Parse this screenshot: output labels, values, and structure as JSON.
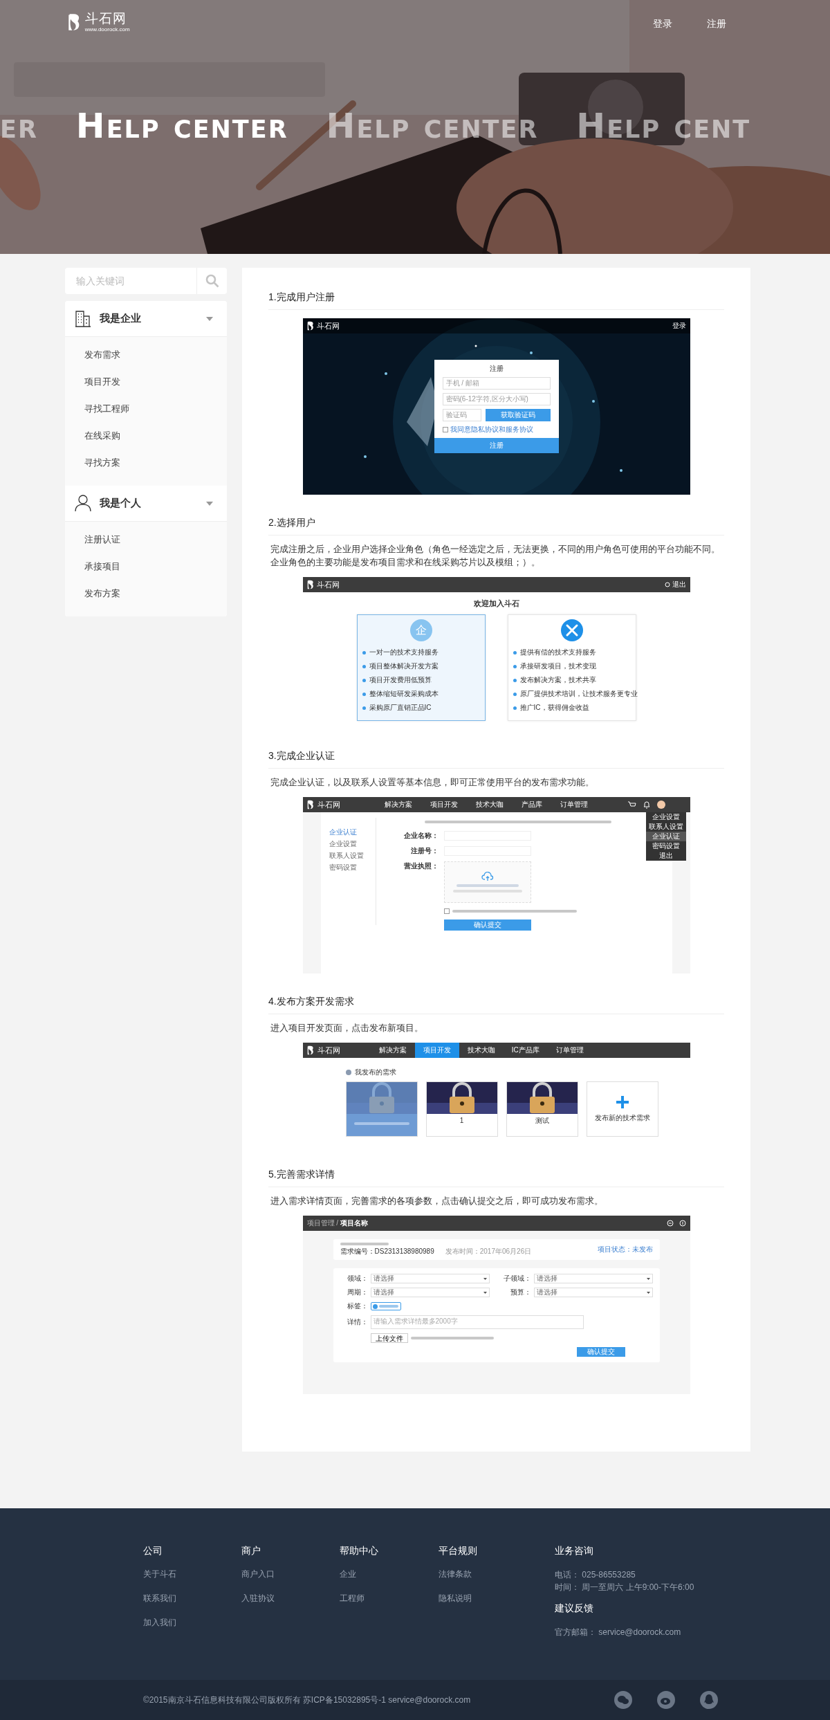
{
  "header": {
    "brand": "斗石网",
    "url": "www.doorock.com",
    "nav": [
      "登录",
      "注册"
    ],
    "banner": [
      {
        "text": "er",
        "highlighted": false
      },
      {
        "text": "Help center",
        "highlighted": true
      },
      {
        "text": "Help center",
        "highlighted": false
      },
      {
        "text": "Help cent",
        "highlighted": false
      }
    ]
  },
  "sidebar": {
    "search_placeholder": "输入关键词",
    "groups": [
      {
        "title": "我是企业",
        "kind": "building",
        "expanded": true,
        "items": [
          "发布需求",
          "项目开发",
          "寻找工程师",
          "在线采购",
          "寻找方案"
        ]
      },
      {
        "title": "我是个人",
        "kind": "person",
        "expanded": true,
        "items": [
          "注册认证",
          "承接项目",
          "发布方案"
        ]
      }
    ]
  },
  "steps": [
    {
      "title": "1.完成用户注册",
      "screen": {
        "kind": "register",
        "brand": "斗石网",
        "nav": "登录",
        "form_title": "注册",
        "fields": [
          "手机 / 邮箱",
          "密码(6-12字符,区分大小写)"
        ],
        "code_placeholder": "验证码",
        "code_button": "获取验证码",
        "agree_text": "我同意隐私协议和服务协议",
        "agree_checked": false,
        "submit": "注册"
      }
    },
    {
      "title": "2.选择用户",
      "description": "完成注册之后，企业用户选择企业角色（角色一经选定之后，无法更换，不同的用户角色可使用的平台功能不同。企业角色的主要功能是发布项目需求和在线采购芯片以及模组；）。",
      "screen": {
        "kind": "roles",
        "brand": "斗石网",
        "exit": "退出",
        "title": "欢迎加入斗石",
        "roles": [
          {
            "kind": "letter",
            "icon_text": "企",
            "selected": true,
            "points": [
              "一对一的技术支持服务",
              "项目整体解决开发方案",
              "项目开发费用低预算",
              "整体缩短研发采购成本",
              "采购原厂直销正品IC"
            ]
          },
          {
            "kind": "tools",
            "selected": false,
            "points": [
              "提供有偿的技术支持服务",
              "承接研发项目，技术变现",
              "发布解决方案，技术共享",
              "原厂提供技术培训，让技术服务更专业",
              "推广IC，获得佣金收益"
            ]
          }
        ]
      }
    },
    {
      "title": "3.完成企业认证",
      "description": "完成企业认证，以及联系人设置等基本信息，即可正常使用平台的发布需求功能。",
      "screen": {
        "kind": "verify",
        "brand": "斗石网",
        "nav": [
          "解决方案",
          "项目开发",
          "技术大咖",
          "产品库",
          "订单管理"
        ],
        "dropdown": [
          {
            "label": "企业设置",
            "selected": false
          },
          {
            "label": "联系人设置",
            "selected": false
          },
          {
            "label": "企业认证",
            "selected": true
          },
          {
            "label": "密码设置",
            "selected": false
          },
          {
            "label": "退出",
            "selected": false
          }
        ],
        "side_menu": [
          {
            "label": "企业认证",
            "selected": true
          },
          {
            "label": "企业设置",
            "selected": false
          },
          {
            "label": "联系人设置",
            "selected": false
          },
          {
            "label": "密码设置",
            "selected": false
          }
        ],
        "fields": [
          {
            "kind": "input",
            "label": "企业名称："
          },
          {
            "kind": "input",
            "label": "注册号："
          },
          {
            "kind": "upload",
            "label": "营业执照："
          }
        ],
        "agree_checked": false,
        "submit": "确认提交"
      }
    },
    {
      "title": "4.发布方案开发需求",
      "description": "进入项目开发页面，点击发布新项目。",
      "screen": {
        "kind": "projects",
        "brand": "斗石网",
        "nav": [
          {
            "label": "解决方案",
            "selected": false
          },
          {
            "label": "项目开发",
            "selected": true
          },
          {
            "label": "技术大咖",
            "selected": false
          },
          {
            "label": "IC产品库",
            "selected": false
          },
          {
            "label": "订单管理",
            "selected": false
          }
        ],
        "heading": "我发布的需求",
        "cards": [
          {
            "kind": "overlay"
          },
          {
            "kind": "picture",
            "caption": "1"
          },
          {
            "kind": "picture",
            "caption": "测试"
          },
          {
            "kind": "add",
            "label": "发布新的技术需求"
          }
        ]
      }
    },
    {
      "title": "5.完善需求详情",
      "description": "进入需求详情页面，完善需求的各项参数，点击确认提交之后，即可成功发布需求。",
      "screen": {
        "kind": "details",
        "breadcrumb": "项目管理 / **项目名称**",
        "number": "需求编号：DS2313138980989",
        "time": "发布时间：2017年06月26日",
        "status": "项目状态：未发布",
        "fields": [
          {
            "label": "领域：",
            "value": "请选择"
          },
          {
            "label": "子领域：",
            "value": "请选择"
          },
          {
            "label": "周期：",
            "value": "请选择"
          },
          {
            "label": "预算：",
            "value": "请选择"
          }
        ],
        "tag_label": "标签：",
        "detail_label": "详情：",
        "detail_placeholder": "请输入需求详情最多2000字",
        "upload": "上传文件",
        "submit": "确认提交"
      }
    }
  ],
  "footer": {
    "columns": [
      {
        "title": "公司",
        "links": [
          "关于斗石",
          "联系我们",
          "加入我们"
        ]
      },
      {
        "title": "商户",
        "links": [
          "商户入口",
          "入驻协议"
        ]
      },
      {
        "title": "帮助中心",
        "links": [
          "企业",
          "工程师"
        ]
      },
      {
        "title": "平台规则",
        "links": [
          "法律条款",
          "隐私说明"
        ]
      }
    ],
    "contact": {
      "title": "业务咨询",
      "lines": [
        "电话： 025-86553285",
        "时间： 周一至周六 上午9:00-下午6:00"
      ],
      "feedback_title": "建议反馈",
      "feedback_lines": [
        "官方邮箱： service@doorock.com"
      ]
    },
    "copyright": "©2015南京斗石信息科技有限公司版权所有 苏ICP备15032895号-1 service@doorock.com"
  }
}
